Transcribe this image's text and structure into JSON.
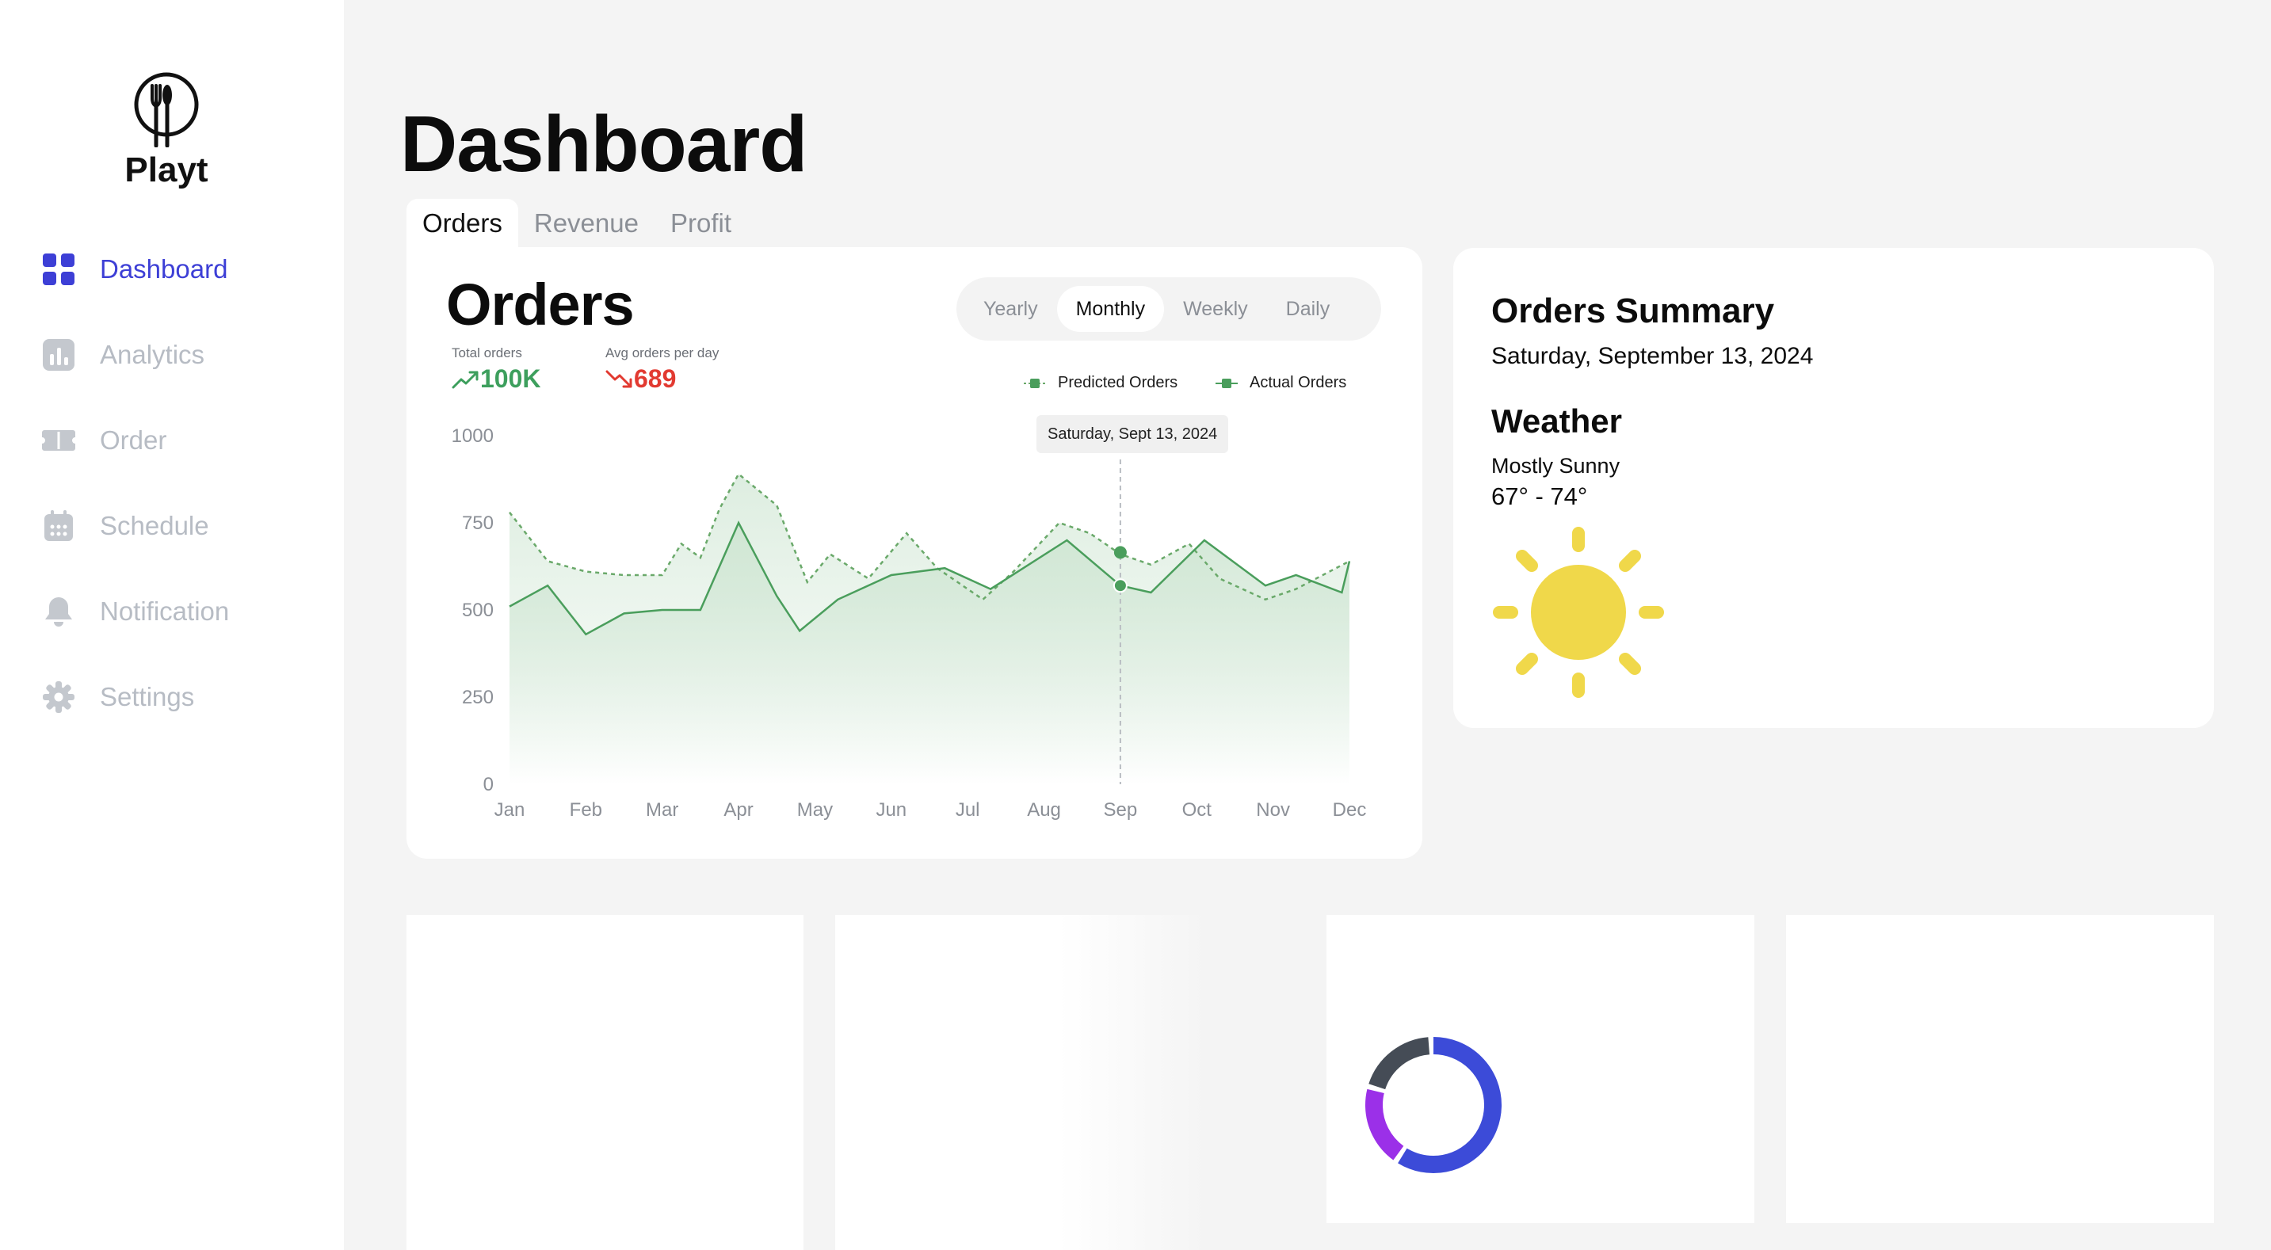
{
  "app": {
    "name": "Playt"
  },
  "sidebar": {
    "items": [
      {
        "label": "Dashboard",
        "icon": "grid-icon",
        "active": true
      },
      {
        "label": "Analytics",
        "icon": "bar-chart-icon",
        "active": false
      },
      {
        "label": "Order",
        "icon": "ticket-icon",
        "active": false
      },
      {
        "label": "Schedule",
        "icon": "calendar-icon",
        "active": false
      },
      {
        "label": "Notification",
        "icon": "bell-icon",
        "active": false
      },
      {
        "label": "Settings",
        "icon": "gear-icon",
        "active": false
      }
    ]
  },
  "page": {
    "title": "Dashboard"
  },
  "tabs": [
    {
      "label": "Orders",
      "active": true
    },
    {
      "label": "Revenue",
      "active": false
    },
    {
      "label": "Profit",
      "active": false
    }
  ],
  "orders_card": {
    "title": "Orders",
    "periods": [
      {
        "label": "Yearly",
        "active": false
      },
      {
        "label": "Monthly",
        "active": true
      },
      {
        "label": "Weekly",
        "active": false
      },
      {
        "label": "Daily",
        "active": false
      }
    ],
    "stats": {
      "total_label": "Total orders",
      "total_value": "100K",
      "total_trend": "up",
      "avg_label": "Avg orders per day",
      "avg_value": "689",
      "avg_trend": "down"
    },
    "tooltip": "Saturday, Sept 13, 2024"
  },
  "chart_data": {
    "type": "area",
    "title": "",
    "xlabel": "",
    "ylabel": "",
    "ylim": [
      0,
      1000
    ],
    "yticks": [
      0,
      250,
      500,
      750,
      1000
    ],
    "grid": false,
    "legend_position": "top-right",
    "x_labels": [
      "Jan",
      "Feb",
      "Mar",
      "Apr",
      "May",
      "Jun",
      "Jul",
      "Aug",
      "Sep",
      "Oct",
      "Nov",
      "Dec"
    ],
    "series": [
      {
        "name": "Predicted Orders",
        "style": "dashed",
        "x": [
          0,
          0.5,
          1,
          1.5,
          2,
          2.25,
          2.5,
          2.75,
          3,
          3.5,
          3.9,
          4.2,
          4.7,
          5.2,
          5.6,
          6.2,
          6.6,
          7.2,
          7.6,
          8,
          8.4,
          8.9,
          9.3,
          9.9,
          10.3,
          11
        ],
        "values": [
          780,
          640,
          610,
          600,
          600,
          690,
          650,
          790,
          890,
          800,
          580,
          660,
          590,
          720,
          620,
          530,
          610,
          750,
          720,
          660,
          630,
          690,
          590,
          530,
          560,
          640
        ]
      },
      {
        "name": "Actual Orders",
        "style": "solid",
        "fill": true,
        "x": [
          0,
          0.5,
          1,
          1.5,
          2,
          2.5,
          3,
          3.5,
          3.8,
          4.3,
          5,
          5.7,
          6.3,
          7.3,
          8,
          8.4,
          9.1,
          9.9,
          10.3,
          10.9,
          11
        ],
        "values": [
          510,
          570,
          430,
          490,
          500,
          500,
          750,
          540,
          440,
          530,
          600,
          620,
          560,
          700,
          570,
          550,
          700,
          570,
          600,
          550,
          640
        ]
      }
    ],
    "highlight": {
      "x": 8,
      "predicted": 665,
      "actual": 570,
      "label": "Saturday, Sept 13, 2024"
    },
    "colors": {
      "predicted": "#6aa96a",
      "actual": "#4a9e5c",
      "fill": "#cfe6d3"
    }
  },
  "summary": {
    "title": "Orders Summary",
    "date": "Saturday, September 13, 2024",
    "weather_title": "Weather",
    "weather_desc": "Mostly Sunny",
    "weather_temp": "67° - 74°",
    "weather_icon": "sun-icon"
  },
  "donut": {
    "segments": [
      {
        "fraction": 0.6,
        "color": "#3c4bd8"
      },
      {
        "fraction": 0.2,
        "color": "#9b30e8"
      },
      {
        "fraction": 0.2,
        "color": "#454c56"
      }
    ]
  },
  "colors": {
    "accent": "#3d3fd6",
    "nav_inactive": "#b7bcc4",
    "up": "#3d9f5d",
    "down": "#e23a31",
    "sun": "#f0d84a"
  }
}
